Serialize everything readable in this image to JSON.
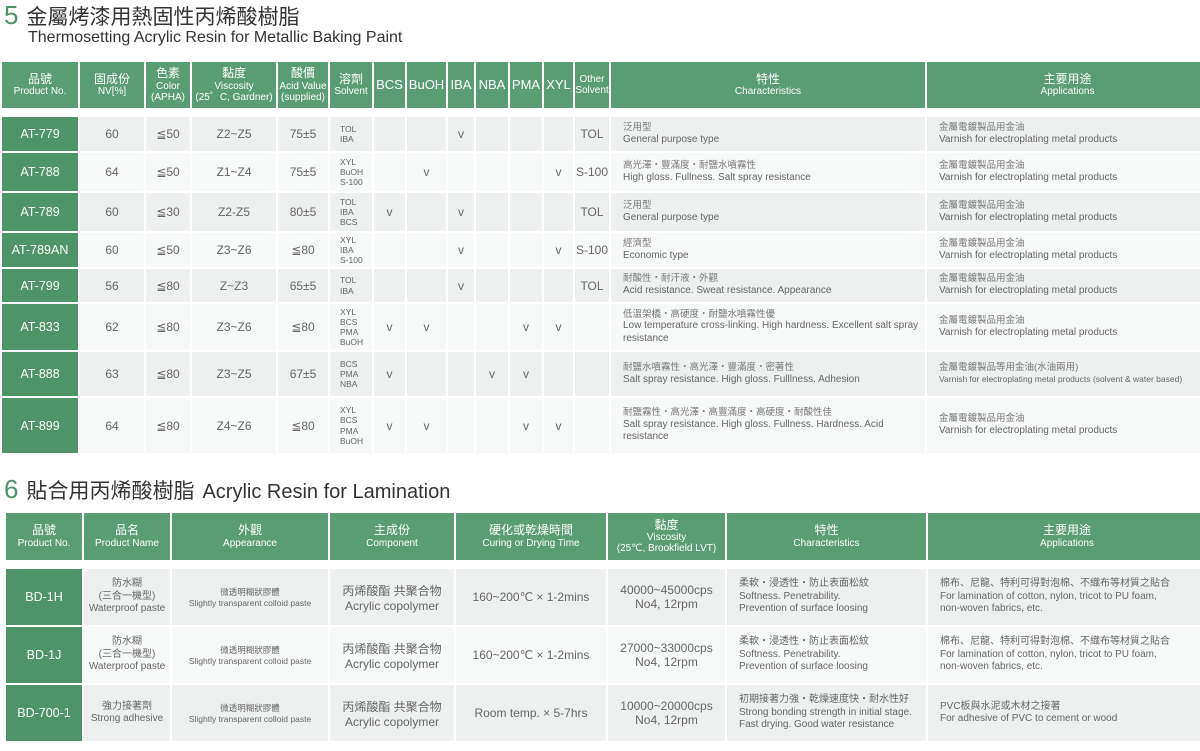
{
  "section5": {
    "number": "5",
    "title_zh": "金屬烤漆用熱固性丙烯酸樹脂",
    "title_en": "Thermosetting Acrylic Resin for Metallic Baking Paint",
    "headers": [
      {
        "zh": "品號",
        "en": "Product No."
      },
      {
        "zh": "固成份",
        "en": "NV[%]"
      },
      {
        "zh": "色素",
        "en": "Color",
        "en2": "(APHA)"
      },
      {
        "zh": "黏度",
        "en": "Viscosity",
        "en2": "(25゜C, Gardner)"
      },
      {
        "zh": "酸價",
        "en": "Acid Value",
        "en2": "(supplied)"
      },
      {
        "zh": "溶劑",
        "en": "Solvent"
      },
      {
        "en": "BCS"
      },
      {
        "en": "BuOH"
      },
      {
        "en": "IBA"
      },
      {
        "en": "NBA"
      },
      {
        "en": "PMA"
      },
      {
        "en": "XYL"
      },
      {
        "en": "Other",
        "en2": "Solvent"
      },
      {
        "zh": "特性",
        "en": "Characteristics"
      },
      {
        "zh": "主要用途",
        "en": "Applications"
      }
    ],
    "check_mark": "v",
    "rows": [
      {
        "product": "AT-779",
        "nv": "60",
        "color": "≦50",
        "viscosity": "Z2~Z5",
        "acid": "75±5",
        "solvent": [
          "TOL",
          "IBA"
        ],
        "checks": [
          false,
          false,
          true,
          false,
          false,
          false
        ],
        "other": "TOL",
        "char_zh": "泛用型",
        "char_en": "General purpose type",
        "app_zh": "金屬電鍍製品用金油",
        "app_en": "Varnish for electroplating metal products"
      },
      {
        "product": "AT-788",
        "nv": "64",
        "color": "≦50",
        "viscosity": "Z1~Z4",
        "acid": "75±5",
        "solvent": [
          "XYL",
          "BuOH",
          "S-100"
        ],
        "checks": [
          false,
          true,
          false,
          false,
          false,
          true
        ],
        "other": "S-100",
        "char_zh": "高光澤・豐滿度・耐鹽水噴霧性",
        "char_en": "High gloss. Fullness. Salt spray resistance",
        "app_zh": "金屬電鍍製品用金油",
        "app_en": "Varnish for electroplating metal products"
      },
      {
        "product": "AT-789",
        "nv": "60",
        "color": "≦30",
        "viscosity": "Z2-Z5",
        "acid": "80±5",
        "solvent": [
          "TOL",
          "IBA",
          "BCS"
        ],
        "checks": [
          true,
          false,
          true,
          false,
          false,
          false
        ],
        "other": "TOL",
        "char_zh": "泛用型",
        "char_en": "General purpose type",
        "app_zh": "金屬電鍍製品用金油",
        "app_en": "Varnish for electroplating metal products"
      },
      {
        "product": "AT-789AN",
        "nv": "60",
        "color": "≦50",
        "viscosity": "Z3~Z6",
        "acid": "≦80",
        "solvent": [
          "XYL",
          "IBA",
          "S-100"
        ],
        "checks": [
          false,
          false,
          true,
          false,
          false,
          true
        ],
        "other": "S-100",
        "char_zh": "經濟型",
        "char_en": "Economic type",
        "app_zh": "金屬電鍍製品用金油",
        "app_en": "Varnish for electroplating metal products"
      },
      {
        "product": "AT-799",
        "nv": "56",
        "color": "≦80",
        "viscosity": "Z~Z3",
        "acid": "65±5",
        "solvent": [
          "TOL",
          "IBA"
        ],
        "checks": [
          false,
          false,
          true,
          false,
          false,
          false
        ],
        "other": "TOL",
        "char_zh": "耐酸性・耐汗液・外觀",
        "char_en": "Acid resistance. Sweat resistance. Appearance",
        "app_zh": "金屬電鍍製品用金油",
        "app_en": "Varnish for electroplating metal products"
      },
      {
        "product": "AT-833",
        "nv": "62",
        "color": "≦80",
        "viscosity": "Z3~Z6",
        "acid": "≦80",
        "solvent": [
          "XYL",
          "BCS",
          "PMA",
          "BuOH"
        ],
        "checks": [
          true,
          true,
          false,
          false,
          true,
          true
        ],
        "other": "",
        "char_zh": "低溫架橋・高硬度・耐鹽水噴霧性優",
        "char_en": "Low temperature cross-linking. High hardness. Excellent salt spray resistance",
        "app_zh": "金屬電鍍製品用金油",
        "app_en": "Varnish for electroplating metal products"
      },
      {
        "product": "AT-888",
        "nv": "63",
        "color": "≦80",
        "viscosity": "Z3~Z5",
        "acid": "67±5",
        "solvent": [
          "BCS",
          "PMA",
          "NBA"
        ],
        "checks": [
          true,
          false,
          false,
          true,
          true,
          false
        ],
        "other": "",
        "char_zh": "耐鹽水噴霧性・高光澤・豐滿度・密著性",
        "char_en": "Salt spray resistance. High gloss. Fulllness. Adhesion",
        "app_zh": "金屬電鍍製品等用金油(水油兩用)",
        "app_en": "Varnish for electroplating metal products (solvent & water based)"
      },
      {
        "product": "AT-899",
        "nv": "64",
        "color": "≦80",
        "viscosity": "Z4~Z6",
        "acid": "≦80",
        "solvent": [
          "XYL",
          "BCS",
          "PMA",
          "BuOH"
        ],
        "checks": [
          true,
          true,
          false,
          false,
          true,
          true
        ],
        "other": "",
        "char_zh": "耐鹽霧性・高光澤・高豐滿度・高硬度・耐酸性佳",
        "char_en": "Salt spray resistance. High gloss. Fullness. Hardness. Acid resistance",
        "app_zh": "金屬電鍍製品用金油",
        "app_en": "Varnish for electroplating metal products"
      }
    ]
  },
  "section6": {
    "number": "6",
    "title_zh": "貼合用丙烯酸樹脂",
    "title_en": "Acrylic Resin for Lamination",
    "headers": [
      {
        "zh": "品號",
        "en": "Product No."
      },
      {
        "zh": "品名",
        "en": "Product Name"
      },
      {
        "zh": "外觀",
        "en": "Appearance"
      },
      {
        "zh": "主成份",
        "en": "Component"
      },
      {
        "zh": "硬化或乾燥時間",
        "en": "Curing or Drying Time"
      },
      {
        "zh": "黏度",
        "en": "Viscosity",
        "en2": "(25℃, Brookfield LVT)"
      },
      {
        "zh": "特性",
        "en": "Characteristics"
      },
      {
        "zh": "主要用途",
        "en": "Applications"
      }
    ],
    "rows": [
      {
        "product": "BD-1H",
        "name": [
          "防水糊",
          "(三合一機型)",
          "Waterproof paste"
        ],
        "appearance": [
          "微透明糊狀膠體",
          "Slightly transparent colloid paste"
        ],
        "component": [
          "丙烯酸酯 共聚合物",
          "Acrylic copolymer"
        ],
        "curing": "160~200℃ × 1-2mins",
        "viscosity": [
          "40000~45000cps",
          "No4, 12rpm"
        ],
        "char": [
          "柔軟・浸透性・防止表面松紋",
          "Softness. Penetrability.",
          "Prevention of surface loosing"
        ],
        "app": [
          "棉布、尼龍、特利可得對泡棉、不織布等材質之貼合",
          "For lamination of cotton, nylon, tricot to PU foam,",
          "non-woven fabrics, etc."
        ]
      },
      {
        "product": "BD-1J",
        "name": [
          "防水糊",
          "(三合一機型)",
          "Waterproof paste"
        ],
        "appearance": [
          "微透明糊狀膠體",
          "Slightly transparent colloid paste"
        ],
        "component": [
          "丙烯酸酯 共聚合物",
          "Acrylic copolymer"
        ],
        "curing": "160~200℃ × 1-2mins",
        "viscosity": [
          "27000~33000cps",
          "No4, 12rpm"
        ],
        "char": [
          "柔軟・浸透性・防止表面松紋",
          "Softness. Penetrability.",
          "Prevention of surface loosing"
        ],
        "app": [
          "棉布、尼龍、特利可得對泡棉、不織布等材質之貼合",
          "For lamination of cotton, nylon, tricot to PU foam,",
          "non-woven fabrics, etc."
        ]
      },
      {
        "product": "BD-700-1",
        "name": [
          "強力接著劑",
          "Strong adhesive"
        ],
        "appearance": [
          "微透明糊狀膠體",
          "Slightly transparent colloid paste"
        ],
        "component": [
          "丙烯酸酯 共聚合物",
          "Acrylic copolymer"
        ],
        "curing": "Room temp. × 5-7hrs",
        "viscosity": [
          "10000~20000cps",
          "No4, 12rpm"
        ],
        "char": [
          "初期接著力強・乾燥速度快・耐水性好",
          "Strong bonding strength in initial stage.",
          "Fast drying. Good water resistance"
        ],
        "app": [
          "PVC板與水泥或木材之接著",
          "For adhesive of PVC to cement or wood"
        ]
      }
    ]
  }
}
